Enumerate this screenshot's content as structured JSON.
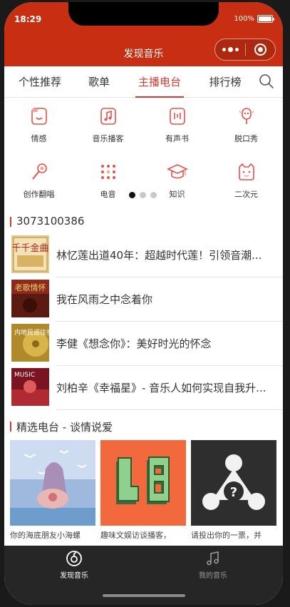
{
  "status": {
    "time": "18:29",
    "battery": "100%",
    "battery_level": 1.0
  },
  "navbar": {
    "title": "发现音乐"
  },
  "tabs": [
    {
      "label": "个性推荐"
    },
    {
      "label": "歌单"
    },
    {
      "label": "主播电台",
      "active": true
    },
    {
      "label": "排行榜"
    }
  ],
  "categories": [
    {
      "label": "情感",
      "icon": "mood-icon"
    },
    {
      "label": "音乐播客",
      "icon": "music-podcast-icon"
    },
    {
      "label": "有声书",
      "icon": "audiobook-icon"
    },
    {
      "label": "脱口秀",
      "icon": "talkshow-mic-icon"
    },
    {
      "label": "创作翻唱",
      "icon": "cover-mic-icon"
    },
    {
      "label": "电音",
      "icon": "electronic-dots-icon"
    },
    {
      "label": "知识",
      "icon": "graduation-cap-icon"
    },
    {
      "label": "二次元",
      "icon": "anime-cat-icon"
    }
  ],
  "carousel": {
    "pages": 3,
    "current": 1
  },
  "section1": {
    "title": "3073100386"
  },
  "radio_list": [
    {
      "text": "林忆莲出道40年：超越时代莲！引领音潮...",
      "thumb_text": "千千金曲"
    },
    {
      "text": "我在风雨之中念着你",
      "thumb_text": "老歌情怀"
    },
    {
      "text": "李健《想念你》：美好时光的怀念",
      "thumb_text": "内地民谣往事"
    },
    {
      "text": "刘柏辛《幸福星》- 音乐人如何实现自我升...",
      "thumb_text": "MUSIC"
    }
  ],
  "section2": {
    "title": "精选电台 - 谈情说爱"
  },
  "cards": [
    {
      "caption": "你的海底朋友小海螺"
    },
    {
      "caption": "趣味文娱访谈播客，"
    },
    {
      "caption": "请投出你的一票，并"
    }
  ],
  "bottom_tabs": [
    {
      "label": "发现音乐",
      "active": true
    },
    {
      "label": "我的音乐",
      "active": false
    }
  ],
  "colors": {
    "brand": "#c72e12",
    "accent": "#d33a31",
    "bottom_bar": "#262626"
  }
}
